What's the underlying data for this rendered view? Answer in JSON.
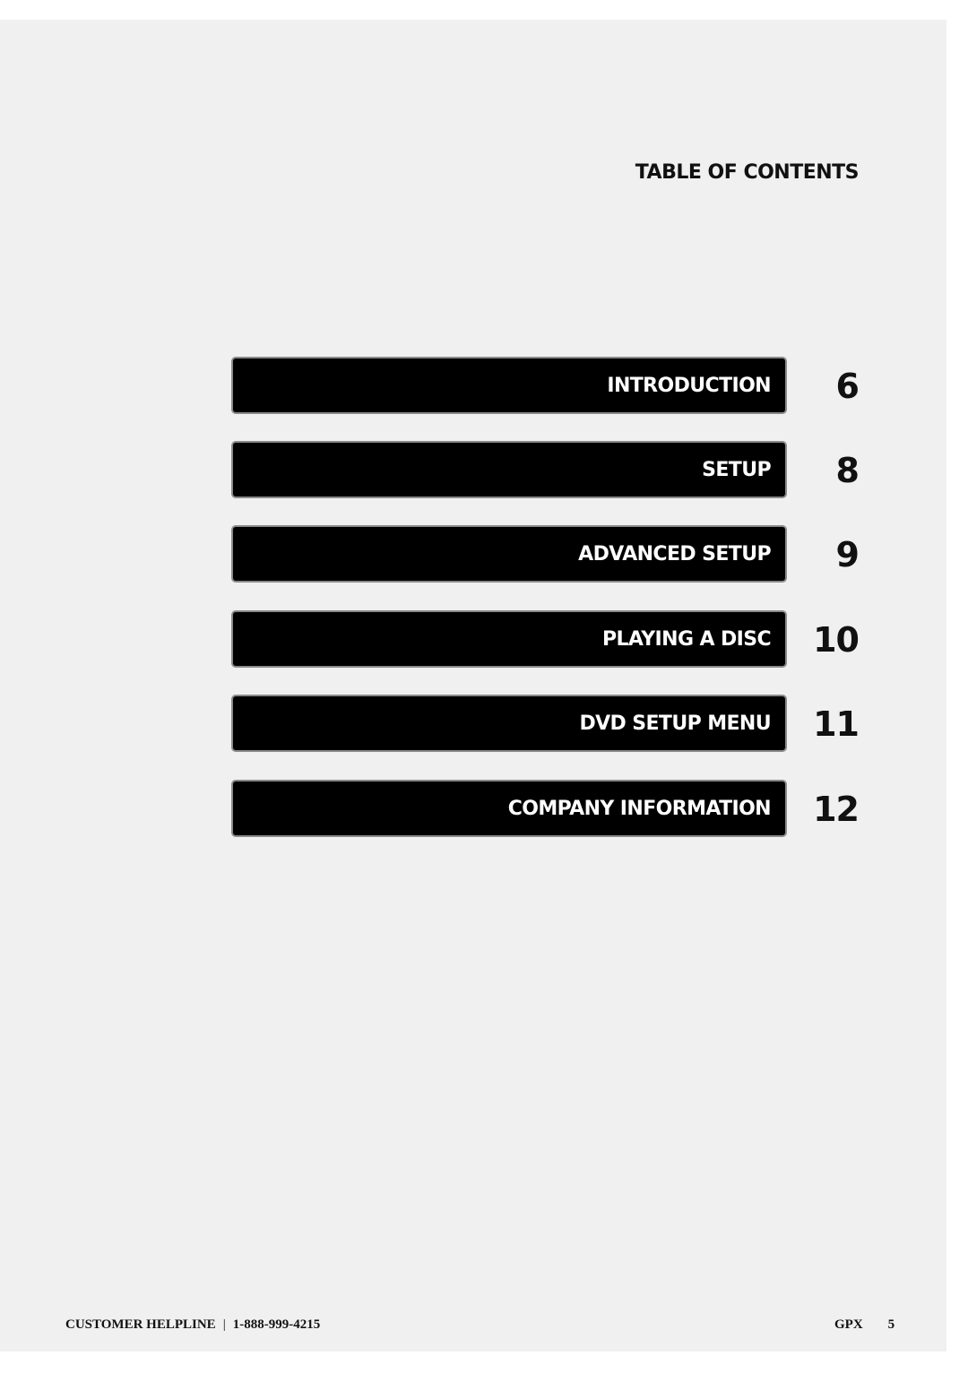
{
  "document": {
    "heading": "TABLE OF CONTENTS",
    "toc": [
      {
        "label": "INTRODUCTION",
        "page": "6"
      },
      {
        "label": "SETUP",
        "page": "8"
      },
      {
        "label": "ADVANCED SETUP",
        "page": "9"
      },
      {
        "label": "PLAYING A DISC",
        "page": "10"
      },
      {
        "label": "DVD SETUP MENU",
        "page": "11"
      },
      {
        "label": "COMPANY INFORMATION",
        "page": "12"
      }
    ],
    "footer": {
      "helpline_label": "CUSTOMER HELPLINE",
      "separator": "|",
      "phone": "1-888-999-4215",
      "brand": "GPX",
      "page_number": "5"
    }
  }
}
